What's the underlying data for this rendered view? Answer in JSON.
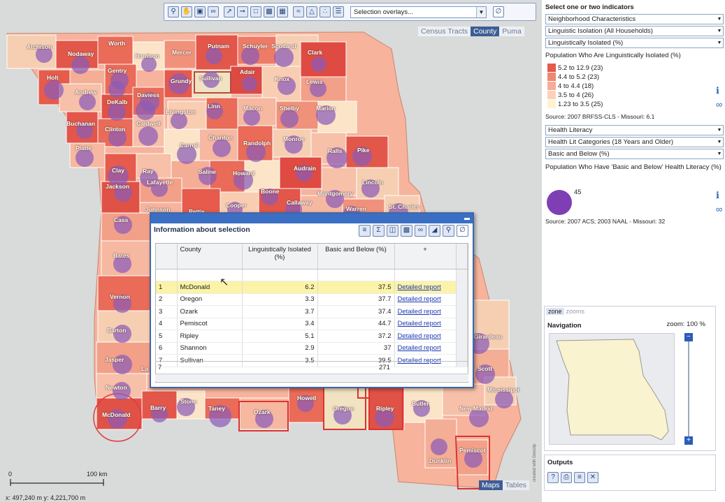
{
  "toolbar": {
    "overlay_select": "Selection overlays...",
    "icons": [
      "zoom-in-icon",
      "pan-hand-icon",
      "zoom-extent-icon",
      "binoculars-icon",
      "select-arrow-icon",
      "select-tool-icon",
      "folder-icon",
      "save-icon",
      "table-icon",
      "layers-icon",
      "chart-icon",
      "points-icon",
      "legend-icon"
    ],
    "clear_icon": "clear-icon"
  },
  "map_tabs": [
    "Census Tracts",
    "County",
    "Puma"
  ],
  "map_tab_active": "County",
  "bottom_tabs": [
    "Maps",
    "Tables"
  ],
  "bottom_tab_active": "Maps",
  "scale": {
    "zero": "0",
    "km": "100 km",
    "coords": "x: 497,240 m   y: 4,221,700 m"
  },
  "counties": [
    "Atchison",
    "Worth",
    "Putnam",
    "Schuyler",
    "Scotland",
    "Clark",
    "Nodaway",
    "Harrison",
    "Mercer",
    "Gentry",
    "Holt",
    "Grundy",
    "Sullivan",
    "Adair",
    "Knox",
    "Lewis",
    "Andrew",
    "Daviess",
    "DeKalb",
    "Linn",
    "Macon",
    "Shelby",
    "Marion",
    "Livingston",
    "Buchanan",
    "Clinton",
    "Caldwell",
    "Chariton",
    "Randolph",
    "Monroe",
    "Carroll",
    "Ralls",
    "Pike",
    "Platte",
    "Clay",
    "Ray",
    "Saline",
    "Howard",
    "Audrain",
    "Jackson",
    "Lafayette",
    "Boone",
    "Lincoln",
    "Montgomery",
    "Cooper",
    "Callaway",
    "St. Charles",
    "Warren",
    "Johnson",
    "Pettis",
    "Cass",
    "Bates",
    "Vernon",
    "Barton",
    "Jasper",
    "La",
    "Newton",
    "McDonald",
    "Barry",
    "Stone",
    "Taney",
    "Ozark",
    "Howell",
    "Oregon",
    "Ripley",
    "Butler",
    "Girardeau",
    "Scott",
    "Mississippi",
    "New Madrid",
    "Dunklin",
    "Pemiscot"
  ],
  "info": {
    "title": "Information about selection",
    "columns": [
      "",
      "County",
      "Linguistically Isolated (%)",
      "Basic and Below (%)",
      "+"
    ],
    "rows": [
      {
        "n": "1",
        "county": "McDonald",
        "li": "6.2",
        "bb": "37.5",
        "link": "Detailed report"
      },
      {
        "n": "2",
        "county": "Oregon",
        "li": "3.3",
        "bb": "37.7",
        "link": "Detailed report"
      },
      {
        "n": "3",
        "county": "Ozark",
        "li": "3.7",
        "bb": "37.4",
        "link": "Detailed report"
      },
      {
        "n": "4",
        "county": "Pemiscot",
        "li": "3.4",
        "bb": "44.7",
        "link": "Detailed report"
      },
      {
        "n": "5",
        "county": "Ripley",
        "li": "5.1",
        "bb": "37.2",
        "link": "Detailed report"
      },
      {
        "n": "6",
        "county": "Shannon",
        "li": "2.9",
        "bb": "37",
        "link": "Detailed report"
      },
      {
        "n": "7",
        "county": "Sullivan",
        "li": "3.5",
        "bb": "39.5",
        "link": "Detailed report"
      }
    ],
    "summary": {
      "count": "7",
      "total": "271"
    },
    "tools": [
      "format-icon",
      "sigma-icon",
      "columns-icon",
      "save-icon",
      "binoculars-icon",
      "chart-icon",
      "search-icon",
      "clear-icon"
    ]
  },
  "panel": {
    "heading": "Select one or two indicators",
    "sel1": "Neighborhood Characteristics",
    "sel2": "Linguistic Isolation (All Households)",
    "sel3": "Linguistically Isolated (%)",
    "legend_title": "Population Who Are Linguistically Isolated (%)",
    "legend": [
      {
        "label": "5.2 to 12.9 (23)",
        "color": "#e55a4a"
      },
      {
        "label": "4.4 to 5.2 (23)",
        "color": "#ef8873"
      },
      {
        "label": "4 to 4.4 (18)",
        "color": "#f6ad97"
      },
      {
        "label": "3.5 to 4 (26)",
        "color": "#fbd2b9"
      },
      {
        "label": "1.23 to 3.5 (25)",
        "color": "#fdf3d2"
      }
    ],
    "source1": "Source: 2007 BRFSS-CLS - Missouri: 6.1",
    "sel4": "Health Literacy",
    "sel5": "Health Lit Categories (18 Years and Older)",
    "sel6": "Basic and Below (%)",
    "legend2_title": "Population Who Have 'Basic and Below' Health Literacy (%)",
    "bubble_value": "45",
    "source2": "Source: 2007 ACS; 2003 NAAL - Missouri: 32",
    "nav_tabs": [
      "zone",
      "zooms"
    ],
    "nav_title": "Navigation",
    "zoom": "zoom: 100 %",
    "outputs": "Outputs",
    "credit": "created with Geoclip"
  }
}
